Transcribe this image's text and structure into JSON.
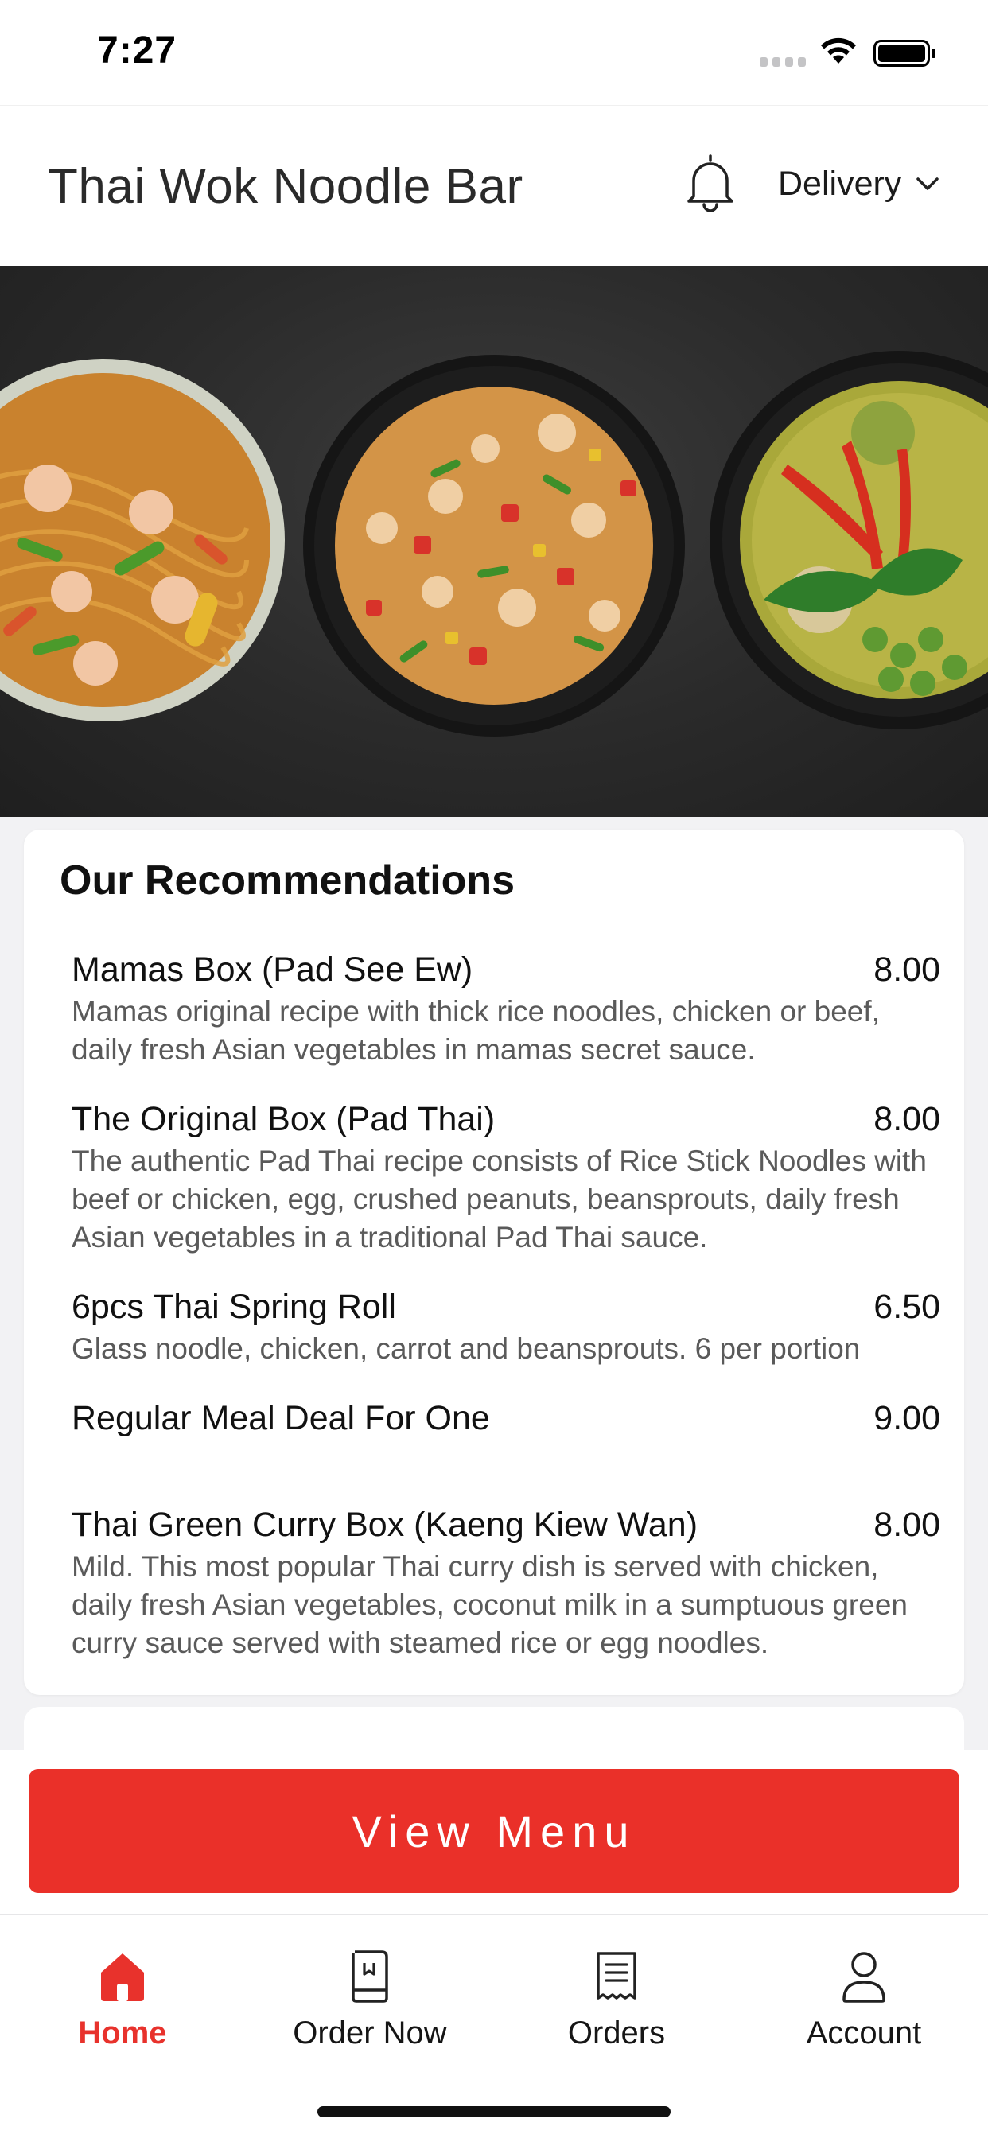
{
  "status_bar": {
    "time": "7:27"
  },
  "header": {
    "title": "Thai Wok Noodle Bar",
    "delivery_label": "Delivery"
  },
  "recommendations": {
    "title": "Our Recommendations",
    "items": [
      {
        "name": "Mamas Box (Pad See Ew)",
        "price": "8.00",
        "description": "Mamas original recipe with thick rice noodles, chicken or beef, daily fresh Asian vegetables in mamas secret sauce."
      },
      {
        "name": "The Original Box (Pad Thai)",
        "price": "8.00",
        "description": "The authentic Pad Thai recipe consists of Rice Stick Noodles with beef or chicken, egg, crushed peanuts, beansprouts, daily fresh Asian vegetables in a traditional Pad Thai sauce."
      },
      {
        "name": "6pcs Thai Spring Roll",
        "price": "6.50",
        "description": "Glass noodle, chicken, carrot and beansprouts. 6 per portion"
      },
      {
        "name": "Regular Meal Deal For One",
        "price": "9.00",
        "description": ""
      },
      {
        "name": "Thai Green Curry Box (Kaeng Kiew Wan)",
        "price": "8.00",
        "description": "Mild. This most popular Thai curry dish is served with chicken, daily fresh Asian vegetables, coconut milk in a sumptuous green curry sauce served with steamed rice or egg noodles."
      }
    ]
  },
  "view_menu_label": "View Menu",
  "tabs": [
    {
      "label": "Home",
      "icon": "home-icon",
      "active": true
    },
    {
      "label": "Order Now",
      "icon": "order-book-icon",
      "active": false
    },
    {
      "label": "Orders",
      "icon": "receipt-icon",
      "active": false
    },
    {
      "label": "Account",
      "icon": "user-icon",
      "active": false
    }
  ],
  "colors": {
    "accent": "#ea3029",
    "background": "#f2f2f4",
    "text": "#1b1b1b",
    "muted_text": "#5a5a5a"
  }
}
